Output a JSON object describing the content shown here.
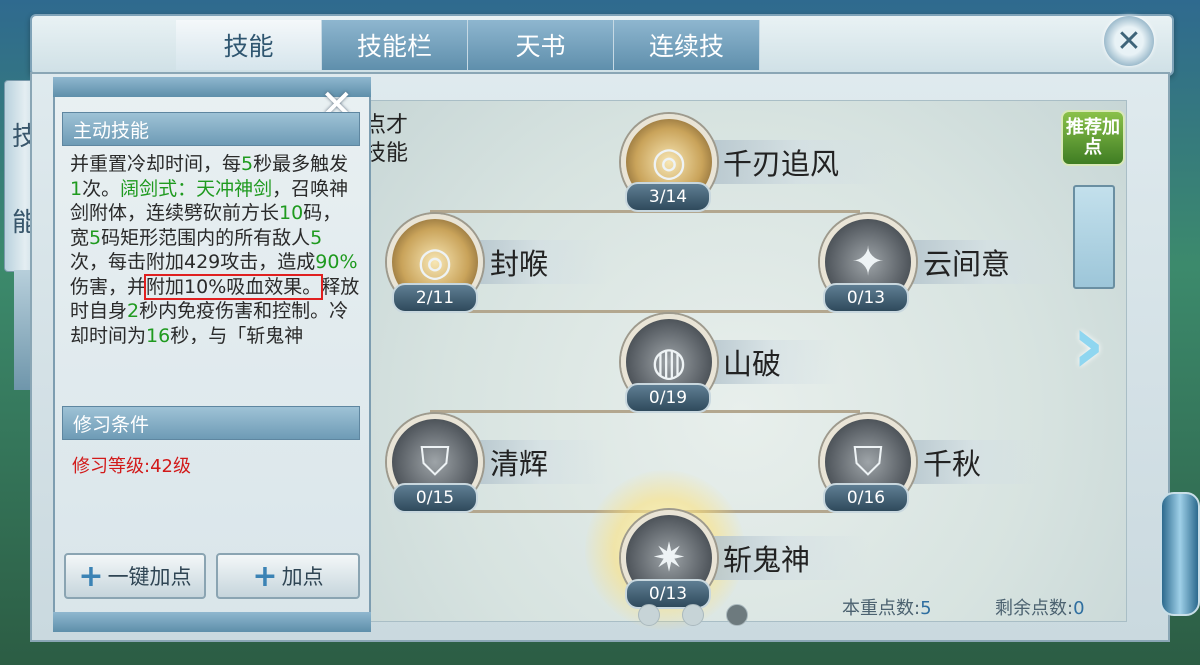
{
  "tabs": [
    {
      "label": "技能"
    },
    {
      "label": "技能栏"
    },
    {
      "label": "天书"
    },
    {
      "label": "连续技"
    }
  ],
  "active_tab": "技能",
  "side_tab": [
    "技",
    "能"
  ],
  "skill_panel": {
    "header": "主动技能",
    "description_parts": [
      {
        "text": "并重置冷却时间，每",
        "color": "normal"
      },
      {
        "text": "5",
        "color": "green"
      },
      {
        "text": "秒最多触发",
        "color": "normal"
      },
      {
        "text": "1",
        "color": "green"
      },
      {
        "text": "次。",
        "color": "normal"
      },
      {
        "text": "阔剑式：天冲神剑",
        "color": "green"
      },
      {
        "text": "，召唤神剑附体，连续劈砍前方长",
        "color": "normal"
      },
      {
        "text": "10",
        "color": "green"
      },
      {
        "text": "码，宽",
        "color": "normal"
      },
      {
        "text": "5",
        "color": "green"
      },
      {
        "text": "码矩形范围内的所有敌人",
        "color": "normal"
      },
      {
        "text": "5",
        "color": "green"
      },
      {
        "text": "次，每击附加429攻击，造成",
        "color": "normal"
      },
      {
        "text": "90%",
        "color": "green"
      },
      {
        "text": "伤害，并",
        "color": "normal"
      },
      {
        "text": "附加10%吸血效果。",
        "color": "boxed"
      },
      {
        "text": "释放时自身",
        "color": "normal"
      },
      {
        "text": "2",
        "color": "green"
      },
      {
        "text": "秒内免疫伤害和控制。冷却时间为",
        "color": "normal"
      },
      {
        "text": "16",
        "color": "green"
      },
      {
        "text": "秒，与「斩鬼神",
        "color": "normal"
      }
    ],
    "requirement_header": "修习条件",
    "requirement": "修习等级:42级",
    "one_click_button": "一键加点",
    "add_point_button": "加点"
  },
  "partial_text": [
    "点才",
    "技能"
  ],
  "recommend_button": "推荐加点",
  "skills": [
    {
      "name": "千刃追风",
      "count": "3/14",
      "glyph": "◎",
      "style": "gold"
    },
    {
      "name": "封喉",
      "count": "2/11",
      "glyph": "◎",
      "style": "gold"
    },
    {
      "name": "云间意",
      "count": "0/13",
      "glyph": "✦",
      "style": "grey"
    },
    {
      "name": "山破",
      "count": "0/19",
      "glyph": "◍",
      "style": "grey"
    },
    {
      "name": "清辉",
      "count": "0/15",
      "glyph": "⛉",
      "style": "grey"
    },
    {
      "name": "千秋",
      "count": "0/16",
      "glyph": "⛉",
      "style": "grey"
    },
    {
      "name": "斩鬼神",
      "count": "0/13",
      "glyph": "✷",
      "style": "grey"
    }
  ],
  "points": {
    "spent_label": "本重点数:",
    "spent": "5",
    "remaining_label": "剩余点数:",
    "remaining": "0"
  },
  "colors": {
    "green": "#1f9a1f",
    "red_box": "#e02020",
    "requirement": "#d21a1a",
    "points_value": "#2f6fa0"
  }
}
